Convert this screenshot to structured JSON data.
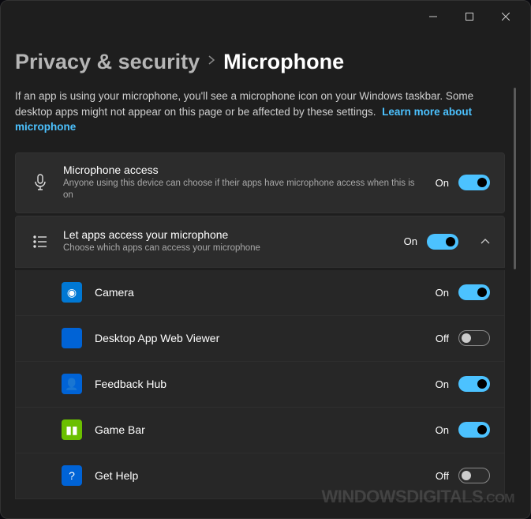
{
  "breadcrumb": {
    "parent": "Privacy & security",
    "current": "Microphone"
  },
  "description": {
    "text": "If an app is using your microphone, you'll see a microphone icon on your Windows taskbar. Some desktop apps might not appear on this page or be affected by these settings.",
    "link": "Learn more about microphone"
  },
  "settings": {
    "micAccess": {
      "title": "Microphone access",
      "subtitle": "Anyone using this device can choose if their apps have microphone access when this is on",
      "stateLabel": "On",
      "on": true
    },
    "appsAccess": {
      "title": "Let apps access your microphone",
      "subtitle": "Choose which apps can access your microphone",
      "stateLabel": "On",
      "on": true
    }
  },
  "apps": [
    {
      "name": "Camera",
      "iconBg": "#0078d4",
      "iconGlyph": "◉",
      "stateLabel": "On",
      "on": true
    },
    {
      "name": "Desktop App Web Viewer",
      "iconBg": "#0063d6",
      "iconGlyph": "",
      "stateLabel": "Off",
      "on": false
    },
    {
      "name": "Feedback Hub",
      "iconBg": "#0063d6",
      "iconGlyph": "👤",
      "stateLabel": "On",
      "on": true
    },
    {
      "name": "Game Bar",
      "iconBg": "#6bbf00",
      "iconGlyph": "▮▮",
      "stateLabel": "On",
      "on": true
    },
    {
      "name": "Get Help",
      "iconBg": "#0063d6",
      "iconGlyph": "?",
      "stateLabel": "Off",
      "on": false
    }
  ],
  "watermark": {
    "main": "WINDOWSDIGITALS",
    "suffix": ".COM"
  }
}
